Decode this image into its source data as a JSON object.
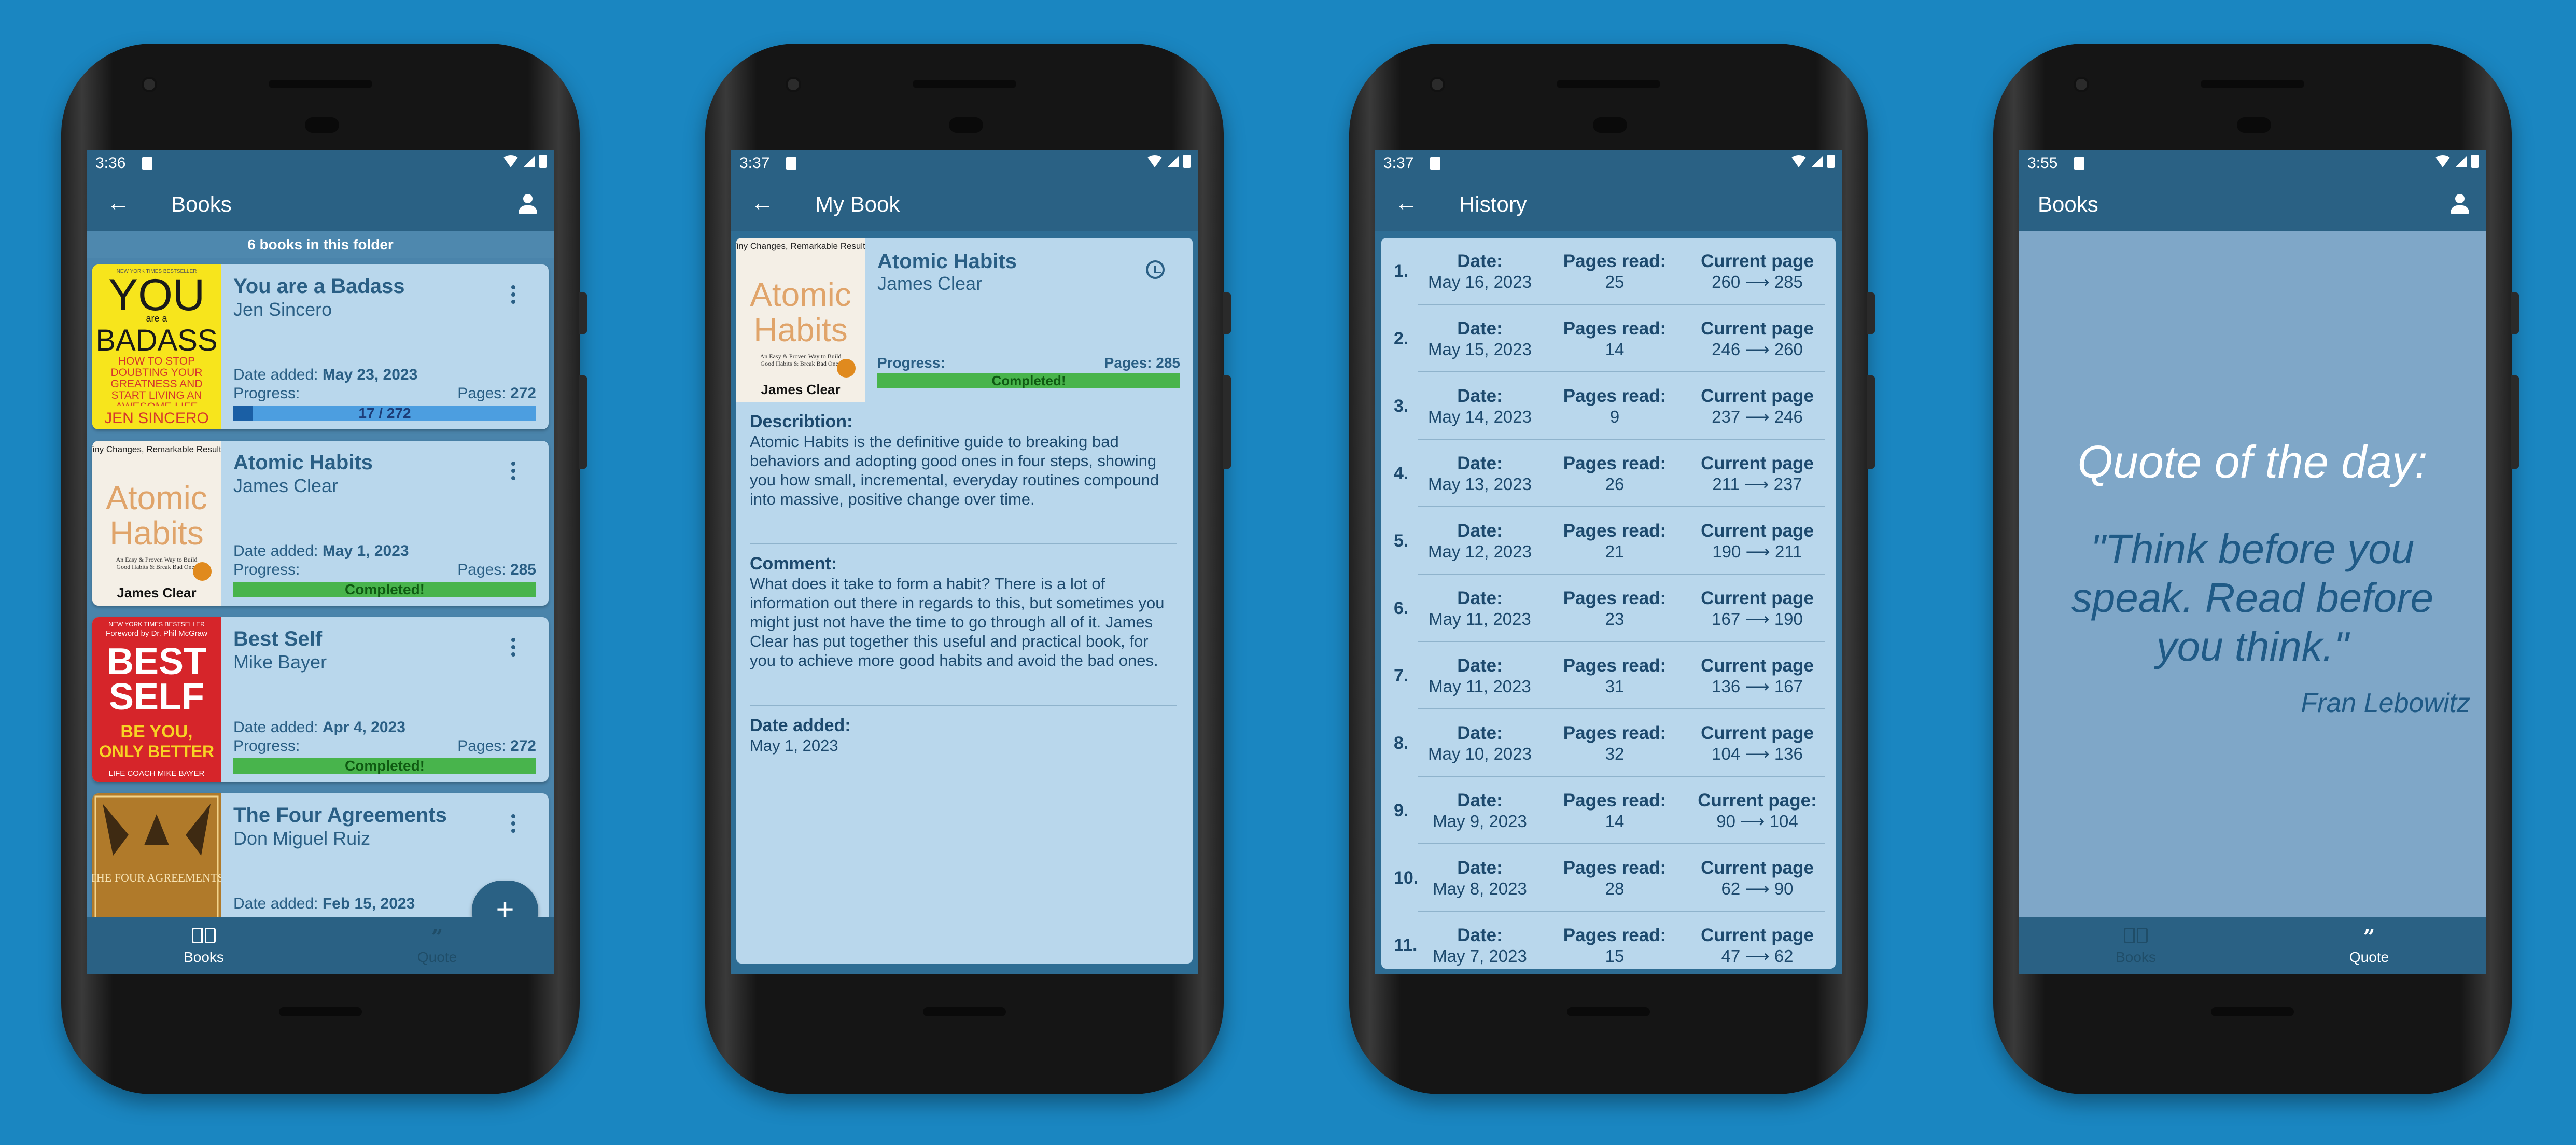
{
  "phones": [
    {
      "status_time": "3:36",
      "title": "Books",
      "folder_count": "6 books in this folder",
      "books": [
        {
          "title": "You are a Badass",
          "author": "Jen Sincero",
          "date_label": "Date added:",
          "date": "May 23, 2023",
          "progress_label": "Progress:",
          "pages_label": "Pages:",
          "pages": "272",
          "bar_text": "17 / 272",
          "progress": 0.0625,
          "completed": false
        },
        {
          "title": "Atomic Habits",
          "author": "James Clear",
          "date_label": "Date added:",
          "date": "May 1, 2023",
          "progress_label": "Progress:",
          "pages_label": "Pages:",
          "pages": "285",
          "bar_text": "Completed!",
          "progress": 1.0,
          "completed": true
        },
        {
          "title": "Best Self",
          "author": "Mike Bayer",
          "date_label": "Date added:",
          "date": "Apr 4, 2023",
          "progress_label": "Progress:",
          "pages_label": "Pages:",
          "pages": "272",
          "bar_text": "Completed!",
          "progress": 1.0,
          "completed": true
        },
        {
          "title": "The Four Agreements",
          "author": "Don Miguel Ruiz",
          "date_label": "Date added:",
          "date": "Feb 15, 2023"
        }
      ],
      "fab_label": "+",
      "nav": [
        {
          "label": "Books",
          "active": true
        },
        {
          "label": "Quote",
          "active": false
        }
      ]
    },
    {
      "status_time": "3:37",
      "title": "My Book",
      "book": {
        "title": "Atomic Habits",
        "author": "James Clear",
        "progress_label": "Progress:",
        "pages": "Pages: 285",
        "bar_text": "Completed!"
      },
      "description_label": "Describtion:",
      "description": "Atomic Habits is the definitive guide to breaking bad behaviors and adopting good ones in four steps, showing you how small, incremental, everyday routines compound into massive, positive change over time.",
      "comment_label": "Comment:",
      "comment": "What does it take to form a habit? There is a lot of information out there in regards to this, but sometimes you might just not have the time to go through all of it. James Clear has put together this useful and practical book, for you to achieve more good habits and avoid the bad ones.",
      "date_label": "Date added:",
      "date": "May 1, 2023"
    },
    {
      "status_time": "3:37",
      "title": "History",
      "rows": [
        {
          "idx": "1.",
          "date_h": "Date:",
          "date": "May 16, 2023",
          "pages_h": "Pages read:",
          "pages": "25",
          "cur_h": "Current page",
          "cur": "260 ⟶ 285"
        },
        {
          "idx": "2.",
          "date_h": "Date:",
          "date": "May 15, 2023",
          "pages_h": "Pages read:",
          "pages": "14",
          "cur_h": "Current page",
          "cur": "246 ⟶ 260"
        },
        {
          "idx": "3.",
          "date_h": "Date:",
          "date": "May 14, 2023",
          "pages_h": "Pages read:",
          "pages": "9",
          "cur_h": "Current page",
          "cur": "237 ⟶ 246"
        },
        {
          "idx": "4.",
          "date_h": "Date:",
          "date": "May 13, 2023",
          "pages_h": "Pages read:",
          "pages": "26",
          "cur_h": "Current page",
          "cur": "211 ⟶ 237"
        },
        {
          "idx": "5.",
          "date_h": "Date:",
          "date": "May 12, 2023",
          "pages_h": "Pages read:",
          "pages": "21",
          "cur_h": "Current page",
          "cur": "190 ⟶ 211"
        },
        {
          "idx": "6.",
          "date_h": "Date:",
          "date": "May 11, 2023",
          "pages_h": "Pages read:",
          "pages": "23",
          "cur_h": "Current page",
          "cur": "167 ⟶ 190"
        },
        {
          "idx": "7.",
          "date_h": "Date:",
          "date": "May 11, 2023",
          "pages_h": "Pages read:",
          "pages": "31",
          "cur_h": "Current page",
          "cur": "136 ⟶ 167"
        },
        {
          "idx": "8.",
          "date_h": "Date:",
          "date": "May 10, 2023",
          "pages_h": "Pages read:",
          "pages": "32",
          "cur_h": "Current page",
          "cur": "104 ⟶ 136"
        },
        {
          "idx": "9.",
          "date_h": "Date:",
          "date": "May 9, 2023",
          "pages_h": "Pages read:",
          "pages": "14",
          "cur_h": "Current page:",
          "cur": "90 ⟶ 104"
        },
        {
          "idx": "10.",
          "date_h": "Date:",
          "date": "May 8, 2023",
          "pages_h": "Pages read:",
          "pages": "28",
          "cur_h": "Current page",
          "cur": "62 ⟶ 90"
        },
        {
          "idx": "11.",
          "date_h": "Date:",
          "date": "May 7, 2023",
          "pages_h": "Pages read:",
          "pages": "15",
          "cur_h": "Current page",
          "cur": "47 ⟶ 62"
        }
      ]
    },
    {
      "status_time": "3:55",
      "title": "Books",
      "quote_heading": "Quote of the day:",
      "quote": "\"Think before you speak. Read before you think.\"",
      "quote_author": "Fran Lebowitz",
      "nav": [
        {
          "label": "Books",
          "active": false
        },
        {
          "label": "Quote",
          "active": true
        }
      ]
    }
  ],
  "covers": {
    "badass": {
      "lines": [
        "YOU",
        "are a",
        "BADASS"
      ],
      "tag": "HOW TO STOP DOUBTING YOUR GREATNESS AND START LIVING AN AWESOME LIFE",
      "author": "JEN SINCERO",
      "top": "NEW YORK TIMES BESTSELLER"
    },
    "atomic": {
      "top": "Tiny Changes, Remarkable Results",
      "title1": "Atomic",
      "title2": "Habits",
      "sub": "An Easy & Proven Way to Build Good Habits & Break Bad Ones",
      "author": "James Clear"
    },
    "best": {
      "top": "NEW YORK TIMES BESTSELLER",
      "fwd": "Foreword by Dr. Phil McGraw",
      "title1": "BEST",
      "title2": "SELF",
      "tag1": "BE YOU,",
      "tag2": "ONLY BETTER",
      "author": "LIFE COACH MIKE BAYER"
    },
    "four": {
      "title": "THE FOUR AGREEMENTS"
    }
  },
  "colors": {
    "background": "#1a86c1",
    "appbar": "#2a6184",
    "card": "#b9d7ec",
    "progress_fill": "#1a5fa5",
    "completed": "#48b44c"
  },
  "icons": [
    "back-arrow-icon",
    "account-icon",
    "more-vert-icon",
    "history-icon",
    "book-icon",
    "quote-icon",
    "wifi-icon",
    "signal-icon",
    "battery-icon",
    "sd-card-icon"
  ]
}
